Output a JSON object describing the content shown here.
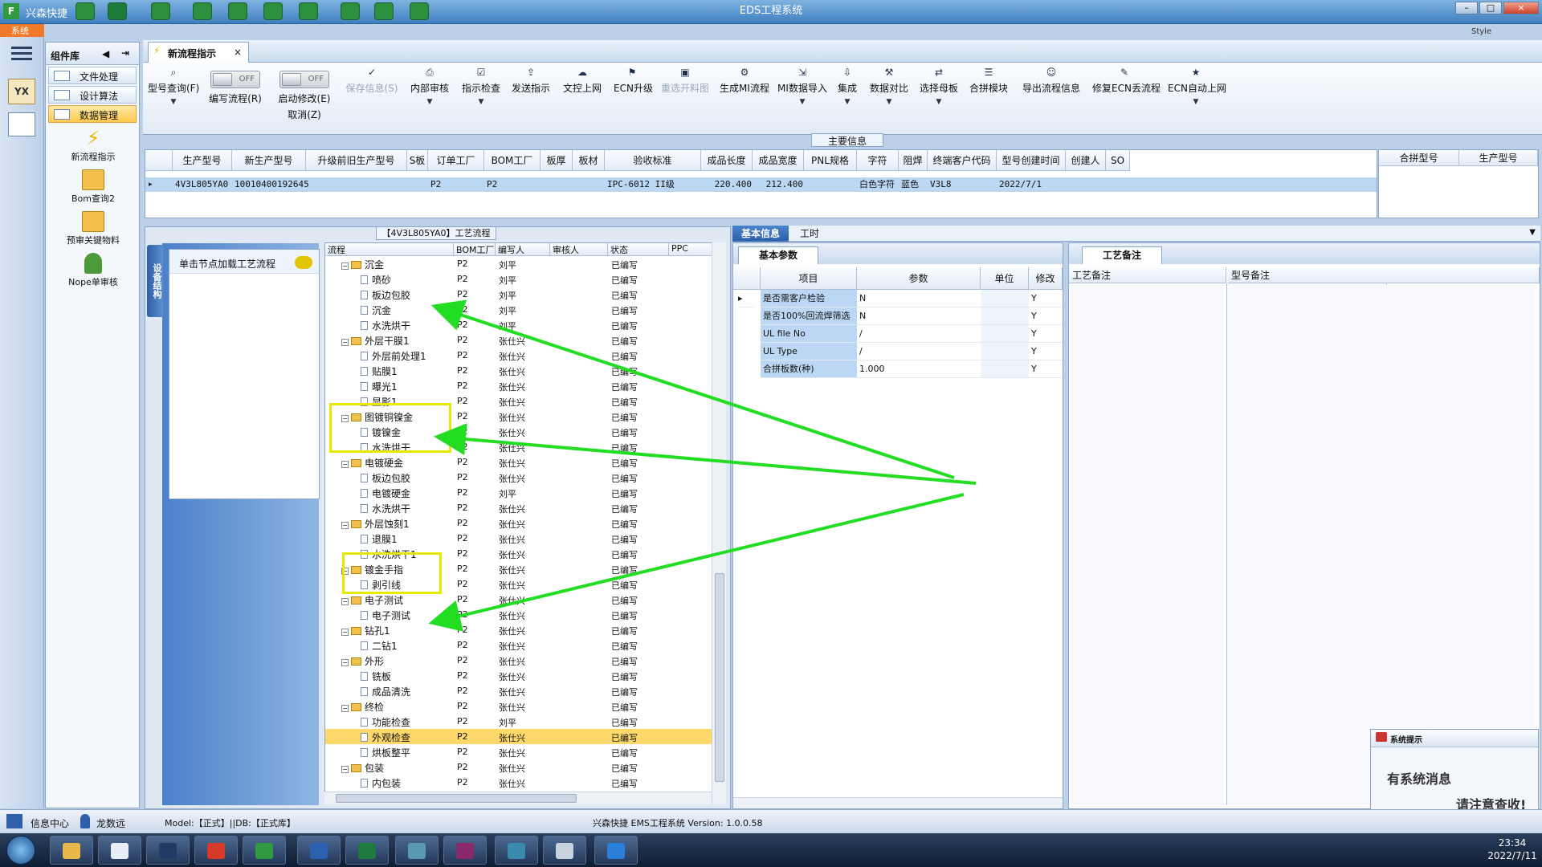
{
  "titlebar": {
    "app": "兴森快捷",
    "title": "EDS工程系统",
    "system_tab": "系统",
    "style_label": "Style"
  },
  "component_panel": {
    "title": "组件库",
    "items": [
      "文件处理",
      "设计算法",
      "数据管理"
    ],
    "selected": "数据管理",
    "nav": [
      "新流程指示",
      "Bom查询2",
      "预审关键物料",
      "Nope单审核"
    ]
  },
  "tab": {
    "label": "新流程指示"
  },
  "toolbar": {
    "b1": "型号查询(F)",
    "toggle1": "编写流程(R)",
    "toggle2a": "启动修改(E)",
    "toggle2b": "取消(Z)",
    "off": "OFF",
    "b2": "保存信息(S)",
    "b3": "内部审核",
    "b4": "指示检查",
    "b5": "发送指示",
    "b6": "文控上网",
    "b7": "ECN升级",
    "b8": "重选开料图",
    "b9": "生成MI流程",
    "b10": "MI数据导入",
    "b11": "集成",
    "b12": "数据对比",
    "b13": "选择母板",
    "b14": "合拼模块",
    "b15": "导出流程信息",
    "b16": "修复ECN丢流程",
    "b17": "ECN自动上网"
  },
  "main_info": {
    "label": "主要信息",
    "headers": [
      "生产型号",
      "新生产型号",
      "升级前旧生产型号",
      "S板",
      "订单工厂",
      "BOM工厂",
      "板厚",
      "板材",
      "验收标准",
      "成品长度",
      "成品宽度",
      "PNL规格",
      "字符",
      "阻焊",
      "终端客户代码",
      "型号创建时间",
      "创建人",
      "SO"
    ],
    "row": {
      "c0": "4V3L805YA0",
      "c1": "10010400192645",
      "c2": "",
      "c3": "",
      "c4": "P2",
      "c5": "P2",
      "c6": "",
      "c7": "",
      "c8": "IPC-6012 II级",
      "c9": "220.400",
      "c10": "212.400",
      "c11": "",
      "c12": "白色字符",
      "c13": "蓝色",
      "c14": "V3L8",
      "c15": "2022/7/1",
      "c16": "",
      "c17": ""
    },
    "right_headers": [
      "合拼型号",
      "生产型号"
    ]
  },
  "flow": {
    "title": "【4V3L805YA0】工艺流程",
    "side_tab": "设备结构",
    "load_hint": "单击节点加载工艺流程",
    "headers": [
      "流程",
      "BOM工厂",
      "编写人",
      "审核人",
      "状态",
      "PPC"
    ],
    "rows": [
      {
        "name": "沉金",
        "type": "folder",
        "f": "P2",
        "w": "刘平",
        "s": "已编写"
      },
      {
        "name": "喷砂",
        "type": "doc",
        "f": "P2",
        "w": "刘平",
        "s": "已编写"
      },
      {
        "name": "板边包胶",
        "type": "doc",
        "f": "P2",
        "w": "刘平",
        "s": "已编写"
      },
      {
        "name": "沉金",
        "type": "doc",
        "f": "P2",
        "w": "刘平",
        "s": "已编写"
      },
      {
        "name": "水洗烘干",
        "type": "doc",
        "f": "P2",
        "w": "刘平",
        "s": "已编写"
      },
      {
        "name": "外层干膜1",
        "type": "folder",
        "f": "P2",
        "w": "张仕兴",
        "s": "已编写"
      },
      {
        "name": "外层前处理1",
        "type": "doc",
        "f": "P2",
        "w": "张仕兴",
        "s": "已编写"
      },
      {
        "name": "贴膜1",
        "type": "doc",
        "f": "P2",
        "w": "张仕兴",
        "s": "已编写"
      },
      {
        "name": "曝光1",
        "type": "doc",
        "f": "P2",
        "w": "张仕兴",
        "s": "已编写"
      },
      {
        "name": "显影1",
        "type": "doc",
        "f": "P2",
        "w": "张仕兴",
        "s": "已编写"
      },
      {
        "name": "图镀铜镍金",
        "type": "folder",
        "f": "P2",
        "w": "张仕兴",
        "s": "已编写"
      },
      {
        "name": "镀镍金",
        "type": "doc",
        "f": "P2",
        "w": "张仕兴",
        "s": "已编写"
      },
      {
        "name": "水洗烘干",
        "type": "doc",
        "f": "P2",
        "w": "张仕兴",
        "s": "已编写"
      },
      {
        "name": "电镀硬金",
        "type": "folder",
        "f": "P2",
        "w": "张仕兴",
        "s": "已编写"
      },
      {
        "name": "板边包胶",
        "type": "doc",
        "f": "P2",
        "w": "张仕兴",
        "s": "已编写"
      },
      {
        "name": "电镀硬金",
        "type": "doc",
        "f": "P2",
        "w": "刘平",
        "s": "已编写"
      },
      {
        "name": "水洗烘干",
        "type": "doc",
        "f": "P2",
        "w": "张仕兴",
        "s": "已编写"
      },
      {
        "name": "外层蚀刻1",
        "type": "folder",
        "f": "P2",
        "w": "张仕兴",
        "s": "已编写"
      },
      {
        "name": "退膜1",
        "type": "doc",
        "f": "P2",
        "w": "张仕兴",
        "s": "已编写"
      },
      {
        "name": "水洗烘干1",
        "type": "doc",
        "f": "P2",
        "w": "张仕兴",
        "s": "已编写"
      },
      {
        "name": "镀金手指",
        "type": "folder",
        "f": "P2",
        "w": "张仕兴",
        "s": "已编写"
      },
      {
        "name": "剥引线",
        "type": "doc",
        "f": "P2",
        "w": "张仕兴",
        "s": "已编写"
      },
      {
        "name": "电子测试",
        "type": "folder",
        "f": "P2",
        "w": "张仕兴",
        "s": "已编写"
      },
      {
        "name": "电子测试",
        "type": "doc",
        "f": "P2",
        "w": "张仕兴",
        "s": "已编写"
      },
      {
        "name": "钻孔1",
        "type": "folder",
        "f": "P2",
        "w": "张仕兴",
        "s": "已编写"
      },
      {
        "name": "二钻1",
        "type": "doc",
        "f": "P2",
        "w": "张仕兴",
        "s": "已编写"
      },
      {
        "name": "外形",
        "type": "folder",
        "f": "P2",
        "w": "张仕兴",
        "s": "已编写"
      },
      {
        "name": "铣板",
        "type": "doc",
        "f": "P2",
        "w": "张仕兴",
        "s": "已编写"
      },
      {
        "name": "成品清洗",
        "type": "doc",
        "f": "P2",
        "w": "张仕兴",
        "s": "已编写"
      },
      {
        "name": "终检",
        "type": "folder",
        "f": "P2",
        "w": "张仕兴",
        "s": "已编写"
      },
      {
        "name": "功能检查",
        "type": "doc",
        "f": "P2",
        "w": "刘平",
        "s": "已编写"
      },
      {
        "name": "外观检查",
        "type": "doc",
        "f": "P2",
        "w": "张仕兴",
        "s": "已编写",
        "selected": true
      },
      {
        "name": "烘板整平",
        "type": "doc",
        "f": "P2",
        "w": "张仕兴",
        "s": "已编写"
      },
      {
        "name": "包装",
        "type": "folder",
        "f": "P2",
        "w": "张仕兴",
        "s": "已编写"
      },
      {
        "name": "内包装",
        "type": "doc",
        "f": "P2",
        "w": "张仕兴",
        "s": "已编写"
      }
    ]
  },
  "right_tabs": {
    "basic": "基本信息",
    "hours": "工时"
  },
  "params": {
    "tab": "基本参数",
    "headers": [
      "项目",
      "参数",
      "单位",
      "修改"
    ],
    "rows": [
      {
        "item": "是否需客户检验",
        "value": "N",
        "unit": "",
        "mod": "Y"
      },
      {
        "item": "是否100%回流焊筛选",
        "value": "N",
        "unit": "",
        "mod": "Y"
      },
      {
        "item": "UL file No",
        "value": "/",
        "unit": "",
        "mod": "Y"
      },
      {
        "item": "UL Type",
        "value": "/",
        "unit": "",
        "mod": "Y"
      },
      {
        "item": "合拼板数(种)",
        "value": "1.000",
        "unit": "",
        "mod": "Y"
      }
    ]
  },
  "notes": {
    "tab": "工艺备注",
    "headers": [
      "工艺备注",
      "型号备注"
    ]
  },
  "notification": {
    "title": "系统提示",
    "line1": "有系统消息",
    "line2": "请注意查收!"
  },
  "statusbar": {
    "info_center": "信息中心",
    "user": "龙数远",
    "model": "Model:【正式】||DB:【正式库】",
    "version": "兴森快捷 EMS工程系统 Version: 1.0.0.58"
  },
  "clock": {
    "time": "23:34",
    "date": "2022/7/11"
  },
  "colors": {
    "accent": "#2a5ea8",
    "arrow": "#22dd22",
    "highlight": "#e8e800",
    "selection": "#ffd86b"
  }
}
